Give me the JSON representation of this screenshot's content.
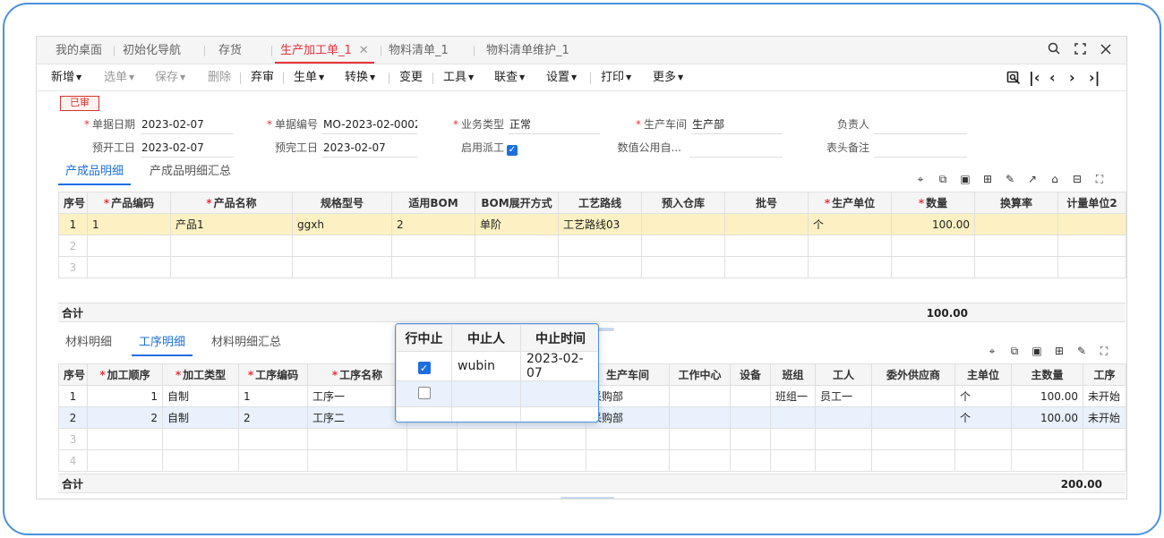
{
  "tabs": [
    {
      "label": "我的桌面"
    },
    {
      "label": "初始化导航"
    },
    {
      "label": "存货"
    },
    {
      "label": "生产加工单_1"
    },
    {
      "label": "物料清单_1"
    },
    {
      "label": "物料清单维护_1"
    }
  ],
  "icons": {
    "window": [
      "search-icon",
      "fullscreen-icon",
      "close-icon"
    ],
    "nav": [
      "first-icon",
      "prev-icon",
      "next-icon",
      "last-icon"
    ],
    "grid_tools": [
      "location-icon",
      "copy-icon",
      "paste-icon",
      "insert-icon",
      "edit-icon",
      "export-icon",
      "home-icon",
      "split-icon",
      "fullscreen-icon"
    ]
  },
  "toolbar": {
    "new": "新增",
    "select": "选单",
    "save": "保存",
    "delete": "删除",
    "unaudit": "弃审",
    "gen": "生单",
    "convert": "转换",
    "change": "变更",
    "tools": "工具",
    "link": "联查",
    "settings": "设置",
    "print": "打印",
    "more": "更多"
  },
  "status_stamp": "已审",
  "header_fields": {
    "doc_date": {
      "label": "单据日期",
      "value": "2023-02-07"
    },
    "doc_no": {
      "label": "单据编号",
      "value": "MO-2023-02-0002"
    },
    "biz_type": {
      "label": "业务类型",
      "value": "正常"
    },
    "workshop": {
      "label": "生产车间",
      "value": "生产部"
    },
    "owner": {
      "label": "负责人",
      "value": ""
    },
    "plan_start": {
      "label": "预开工日",
      "value": "2023-02-07"
    },
    "plan_end": {
      "label": "预完工日",
      "value": "2023-02-07"
    },
    "dispatch": {
      "label": "启用派工",
      "value": "✓"
    },
    "numeric": {
      "label": "数值公用自...",
      "value": ""
    },
    "remark": {
      "label": "表头备注",
      "value": ""
    }
  },
  "product_tabs": {
    "detail": "产成品明细",
    "summary": "产成品明细汇总"
  },
  "product_grid": {
    "headers": [
      "序号",
      "产品编码",
      "产品名称",
      "规格型号",
      "适用BOM",
      "BOM展开方式",
      "工艺路线",
      "预入仓库",
      "批号",
      "生产单位",
      "数量",
      "换算率",
      "计量单位2"
    ],
    "rows": [
      {
        "idx": "1",
        "code": "1",
        "name": "产品1",
        "spec": "ggxh",
        "bom": "2",
        "expand": "单阶",
        "route": "工艺路线03",
        "wh": "",
        "batch": "",
        "unit": "个",
        "qty": "100.00",
        "rate": "",
        "unit2": ""
      },
      {
        "idx": "2"
      },
      {
        "idx": "3"
      }
    ],
    "total_label": "合计",
    "total_qty": "100.00"
  },
  "process_tabs": {
    "material": "材料明细",
    "process": "工序明细",
    "summary": "材料明细汇总"
  },
  "process_grid": {
    "headers": [
      "序号",
      "加工顺序",
      "加工类型",
      "工序编码",
      "工序名称",
      "",
      "",
      "",
      "生产车间",
      "工作中心",
      "设备",
      "班组",
      "工人",
      "委外供应商",
      "主单位",
      "主数量",
      "工序"
    ],
    "rows": [
      {
        "idx": "1",
        "seq": "1",
        "type": "自制",
        "code": "1",
        "name": "工序一",
        "dept": "采购部",
        "team": "班组一",
        "worker": "员工一",
        "unit": "个",
        "qty": "100.00",
        "status": "未开始"
      },
      {
        "idx": "2",
        "seq": "2",
        "type": "自制",
        "code": "2",
        "name": "工序二",
        "dept": "采购部",
        "team": "",
        "worker": "",
        "unit": "个",
        "qty": "100.00",
        "status": "未开始"
      },
      {
        "idx": "3"
      },
      {
        "idx": "4"
      }
    ],
    "total_label": "合计",
    "total_qty": "200.00"
  },
  "popup": {
    "headers": [
      "行中止",
      "中止人",
      "中止时间"
    ],
    "rows": [
      {
        "checked": true,
        "user": "wubin",
        "time": "2023-02-07"
      },
      {
        "checked": false,
        "user": "",
        "time": ""
      }
    ]
  }
}
